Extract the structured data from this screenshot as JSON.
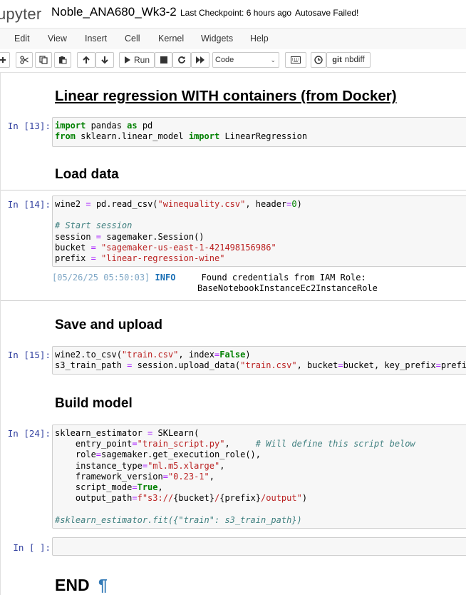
{
  "header": {
    "logo_text": "upyter",
    "notebook_name": "Noble_ANA680_Wk3-2",
    "checkpoint": "Last Checkpoint: 6 hours ago",
    "autosave": "Autosave Failed!"
  },
  "menubar": {
    "items": [
      "Edit",
      "View",
      "Insert",
      "Cell",
      "Kernel",
      "Widgets",
      "Help"
    ]
  },
  "toolbar": {
    "run_label": "Run",
    "cell_type": "Code",
    "nbdiff_label": "nbdiff",
    "git_label": "git"
  },
  "cells": {
    "h_linear": "Linear regression WITH containers (from Docker)",
    "c13_prompt": "In [13]:",
    "h_load": "Load data",
    "c14_prompt": "In [14]:",
    "c14_out": {
      "timestamp": "[05/26/25 05:50:03]",
      "level": "INFO",
      "msg1": "Found credentials from IAM Role:",
      "msg2": "BaseNotebookInstanceEc2InstanceRole"
    },
    "h_save": "Save and upload",
    "c15_prompt": "In [15]:",
    "h_build": "Build model",
    "c24_prompt": "In [24]:",
    "empty_prompt": "In [ ]:",
    "h_end": "END",
    "pilcrow": "¶"
  },
  "code": {
    "c13": [
      [
        [
          "kw",
          "import"
        ],
        [
          "t",
          " pandas "
        ],
        [
          "kw",
          "as"
        ],
        [
          "t",
          " pd"
        ]
      ],
      [
        [
          "kw",
          "from"
        ],
        [
          "t",
          " sklearn.linear_model "
        ],
        [
          "kw",
          "import"
        ],
        [
          "t",
          " LinearRegression"
        ]
      ]
    ],
    "c14": [
      [
        [
          "t",
          "wine2 "
        ],
        [
          "op",
          "="
        ],
        [
          "t",
          " pd.read_csv("
        ],
        [
          "str",
          "\"winequality.csv\""
        ],
        [
          "t",
          ", header"
        ],
        [
          "op",
          "="
        ],
        [
          "num",
          "0"
        ],
        [
          "t",
          ")"
        ]
      ],
      [
        [
          "t",
          ""
        ]
      ],
      [
        [
          "cm",
          "# Start session"
        ]
      ],
      [
        [
          "t",
          "session "
        ],
        [
          "op",
          "="
        ],
        [
          "t",
          " sagemaker.Session()"
        ]
      ],
      [
        [
          "t",
          "bucket "
        ],
        [
          "op",
          "="
        ],
        [
          "t",
          " "
        ],
        [
          "str",
          "\"sagemaker-us-east-1-421498156986\""
        ]
      ],
      [
        [
          "t",
          "prefix "
        ],
        [
          "op",
          "="
        ],
        [
          "t",
          " "
        ],
        [
          "str",
          "\"linear-regression-wine\""
        ]
      ]
    ],
    "c15": [
      [
        [
          "t",
          "wine2.to_csv("
        ],
        [
          "str",
          "\"train.csv\""
        ],
        [
          "t",
          ", index"
        ],
        [
          "op",
          "="
        ],
        [
          "kw",
          "False"
        ],
        [
          "t",
          ")"
        ]
      ],
      [
        [
          "t",
          "s3_train_path "
        ],
        [
          "op",
          "="
        ],
        [
          "t",
          " session.upload_data("
        ],
        [
          "str",
          "\"train.csv\""
        ],
        [
          "t",
          ", bucket"
        ],
        [
          "op",
          "="
        ],
        [
          "t",
          "bucket, key_prefix"
        ],
        [
          "op",
          "="
        ],
        [
          "t",
          "prefix)"
        ]
      ]
    ],
    "c24": [
      [
        [
          "t",
          "sklearn_estimator "
        ],
        [
          "op",
          "="
        ],
        [
          "t",
          " SKLearn("
        ]
      ],
      [
        [
          "t",
          "    entry_point"
        ],
        [
          "op",
          "="
        ],
        [
          "str",
          "\"train_script.py\""
        ],
        [
          "t",
          ",     "
        ],
        [
          "cm",
          "# Will define this script below"
        ]
      ],
      [
        [
          "t",
          "    role"
        ],
        [
          "op",
          "="
        ],
        [
          "t",
          "sagemaker.get_execution_role(),"
        ]
      ],
      [
        [
          "t",
          "    instance_type"
        ],
        [
          "op",
          "="
        ],
        [
          "str",
          "\"ml.m5.xlarge\""
        ],
        [
          "t",
          ","
        ]
      ],
      [
        [
          "t",
          "    framework_version"
        ],
        [
          "op",
          "="
        ],
        [
          "str",
          "\"0.23-1\""
        ],
        [
          "t",
          ","
        ]
      ],
      [
        [
          "t",
          "    script_mode"
        ],
        [
          "op",
          "="
        ],
        [
          "kw",
          "True"
        ],
        [
          "t",
          ","
        ]
      ],
      [
        [
          "t",
          "    output_path"
        ],
        [
          "op",
          "="
        ],
        [
          "str",
          "f\"s3://"
        ],
        [
          "t",
          "{bucket}"
        ],
        [
          "str",
          "/"
        ],
        [
          "t",
          "{prefix}"
        ],
        [
          "str",
          "/output\""
        ],
        [
          "t",
          ")"
        ]
      ],
      [
        [
          "t",
          ""
        ]
      ],
      [
        [
          "cm",
          "#sklearn_estimator.fit({\"train\": s3_train_path})"
        ]
      ]
    ]
  },
  "colors": {
    "keyword": "#008000",
    "string": "#ba2121",
    "comment": "#408080",
    "operator": "#aa22ff",
    "prompt": "#303f9f"
  }
}
